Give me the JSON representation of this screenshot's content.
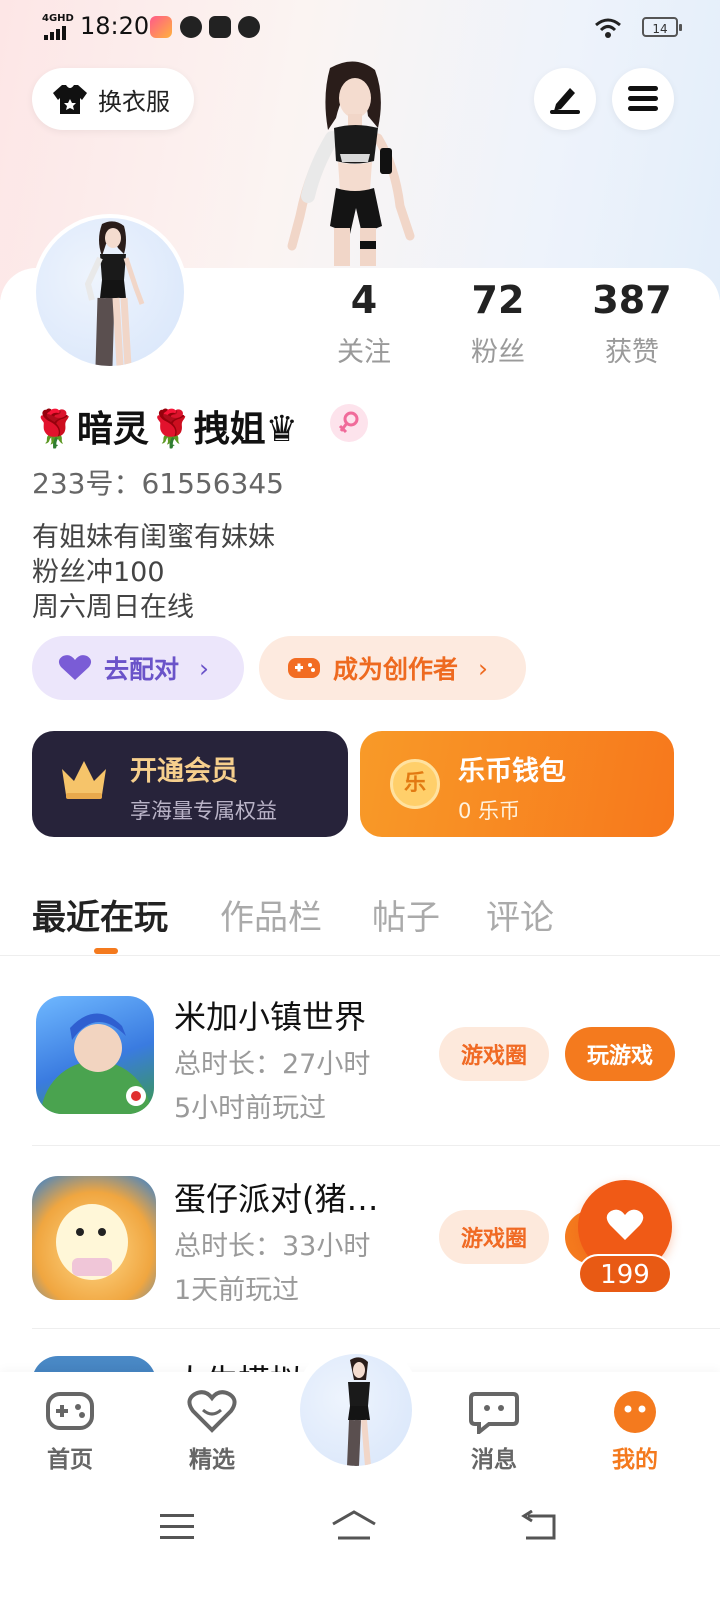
{
  "status_bar": {
    "network": "4GHD",
    "time": "18:20",
    "battery": "14"
  },
  "header": {
    "outfit_button": "换衣服"
  },
  "profile": {
    "stats": [
      {
        "value": "4",
        "label": "关注"
      },
      {
        "value": "72",
        "label": "粉丝"
      },
      {
        "value": "387",
        "label": "获赞"
      }
    ],
    "name": "🌹暗灵🌹拽姐♛",
    "id_line": "233号：61556345",
    "bio": [
      "有姐妹有闺蜜有妹妹",
      "粉丝冲100",
      "周六周日在线"
    ],
    "chips": {
      "match": "去配对",
      "creator": "成为创作者"
    }
  },
  "cards": {
    "vip": {
      "title": "开通会员",
      "subtitle": "享海量专属权益"
    },
    "wallet": {
      "title": "乐币钱包",
      "subtitle": "0 乐币",
      "coin_glyph": "乐"
    }
  },
  "tabs": [
    "最近在玩",
    "作品栏",
    "帖子",
    "评论"
  ],
  "games": [
    {
      "title": "米加小镇世界",
      "duration": "总时长：27小时",
      "last_played": "5小时前玩过",
      "circle_label": "游戏圈",
      "play_label": "玩游戏"
    },
    {
      "title": "蛋仔派对(猪…",
      "duration": "总时长：33小时",
      "last_played": "1天前玩过",
      "circle_label": "游戏圈"
    },
    {
      "title": "人生模拟"
    }
  ],
  "like_float": {
    "count": "199"
  },
  "bottom_nav": [
    {
      "label": "首页"
    },
    {
      "label": "精选"
    },
    {
      "label": "消息"
    },
    {
      "label": "我的"
    }
  ],
  "colors": {
    "accent": "#f47a1e",
    "vip_card": "#27233a",
    "match_chip_bg": "#ece6fb",
    "match_text": "#6a53c9",
    "creator_chip_bg": "#fdeadf"
  }
}
